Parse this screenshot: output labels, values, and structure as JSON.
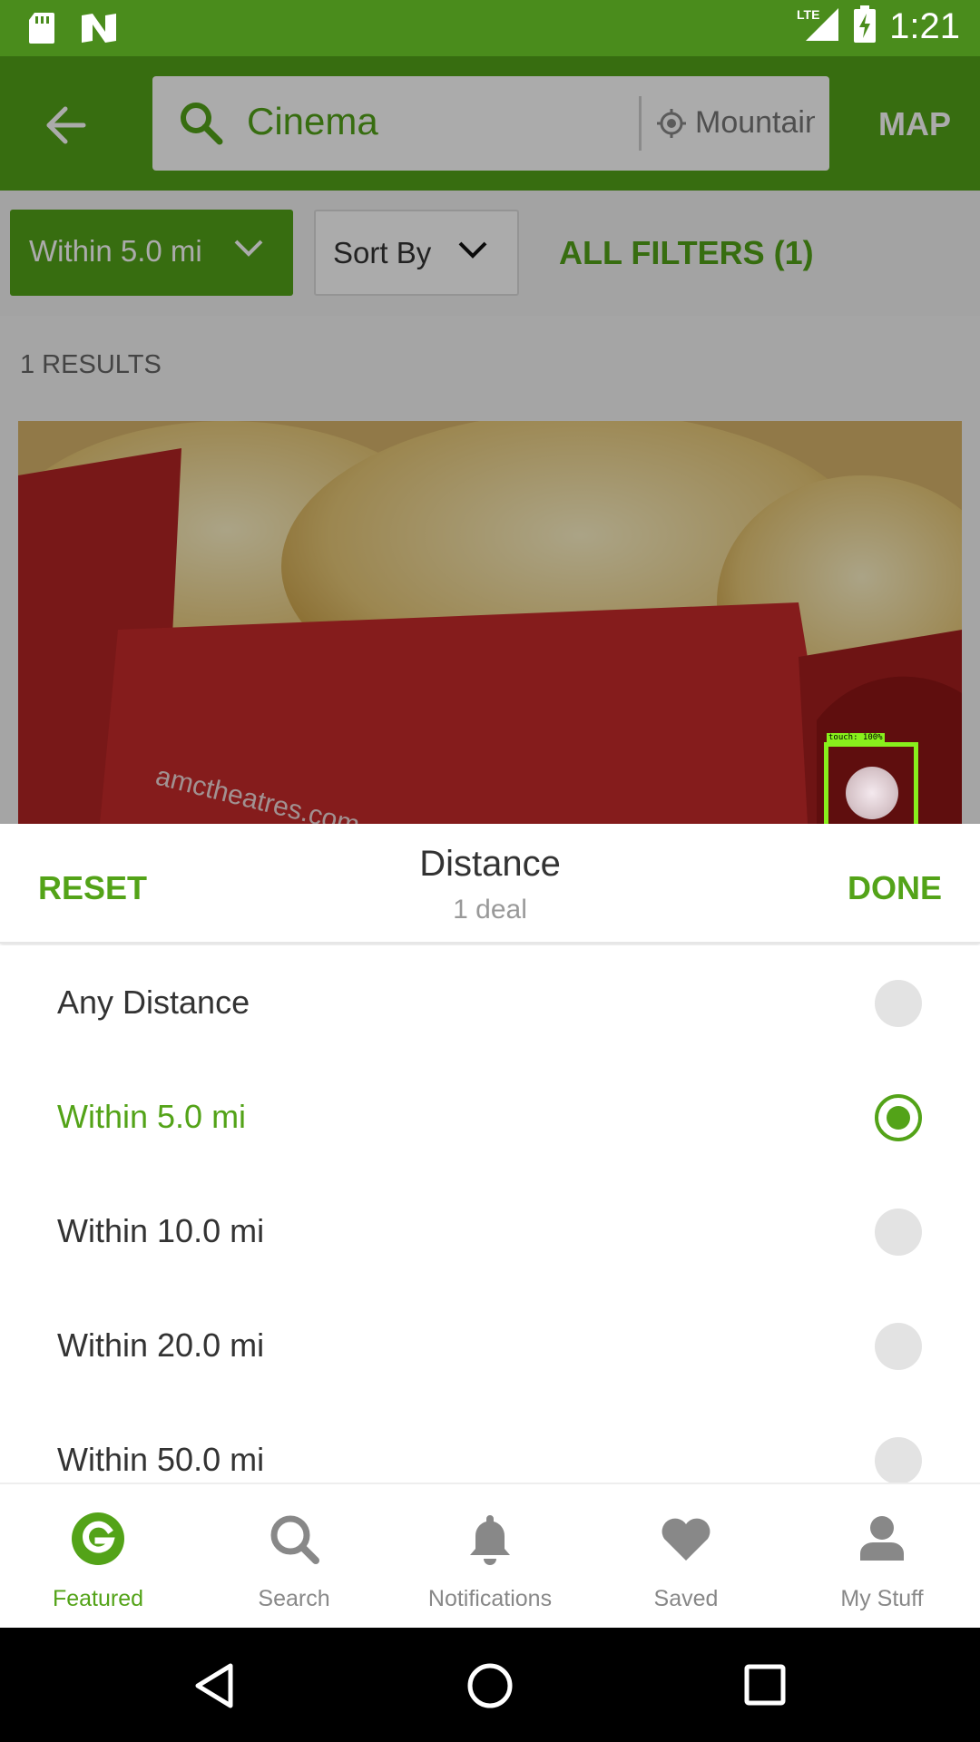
{
  "status_bar": {
    "time": "1:21",
    "network": "LTE",
    "icons": [
      "sd-card-icon",
      "n-logo-icon",
      "signal-icon",
      "battery-charging-icon"
    ]
  },
  "app_bar": {
    "search_query": "Cinema",
    "location_text": "Mountain View",
    "map_label": "MAP",
    "icons": [
      "back-arrow-icon",
      "search-icon",
      "location-icon"
    ]
  },
  "filters": {
    "distance_chip": "Within 5.0 mi",
    "sort_chip": "Sort By",
    "all_filters": "ALL FILTERS (1)"
  },
  "results": {
    "count_label": "1 RESULTS",
    "image_subject": "popcorn"
  },
  "touch_overlay": {
    "label": "touch: 100%"
  },
  "sheet": {
    "reset_label": "RESET",
    "title": "Distance",
    "subtitle": "1 deal",
    "done_label": "DONE",
    "options": [
      {
        "label": "Any Distance",
        "selected": false
      },
      {
        "label": "Within 5.0 mi",
        "selected": true
      },
      {
        "label": "Within 10.0 mi",
        "selected": false
      },
      {
        "label": "Within 20.0 mi",
        "selected": false
      },
      {
        "label": "Within 50.0 mi",
        "selected": false
      }
    ]
  },
  "bottom_nav": {
    "items": [
      {
        "label": "Featured",
        "icon": "groupon-g-icon",
        "active": true
      },
      {
        "label": "Search",
        "icon": "search-icon",
        "active": false
      },
      {
        "label": "Notifications",
        "icon": "bell-icon",
        "active": false
      },
      {
        "label": "Saved",
        "icon": "heart-icon",
        "active": false
      },
      {
        "label": "My Stuff",
        "icon": "person-icon",
        "active": false
      }
    ]
  },
  "colors": {
    "brand_green": "#53a318",
    "status_bar_green": "#4a8c1c",
    "touch_indicator": "#88f01c"
  }
}
